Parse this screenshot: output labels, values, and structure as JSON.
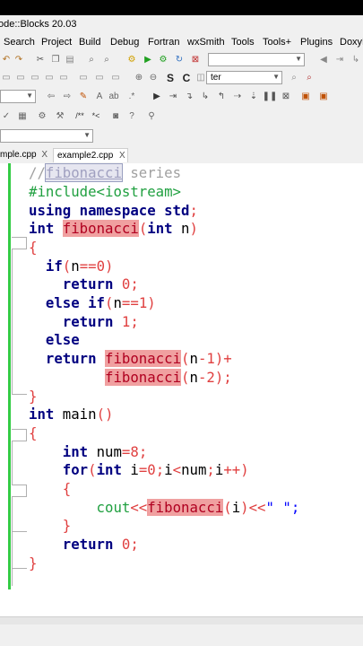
{
  "window": {
    "title": "ode::Blocks 20.03"
  },
  "menu": [
    "Search",
    "Project",
    "Build",
    "Debug",
    "Fortran",
    "wxSmith",
    "Tools",
    "Tools+",
    "Plugins",
    "DoxyB"
  ],
  "toolbar": {
    "search_combo": "ter"
  },
  "tabs": [
    {
      "label": "mple.cpp",
      "close": "X",
      "active": false
    },
    {
      "label": "example2.cpp",
      "close": "X",
      "active": true
    }
  ],
  "code_lines": [
    [
      {
        "t": "//",
        "c": "cm"
      },
      {
        "t": "fibonacci",
        "c": "hlc"
      },
      {
        "t": " series",
        "c": "cm"
      }
    ],
    [
      {
        "t": "#include<iostream>",
        "c": "pp"
      }
    ],
    [
      {
        "t": "using namespace std",
        "c": "kw"
      },
      {
        "t": ";",
        "c": "op"
      }
    ],
    [
      {
        "t": "int",
        "c": "kw"
      },
      {
        "t": " ",
        "c": "id"
      },
      {
        "t": "fibonacci",
        "c": "hl"
      },
      {
        "t": "(",
        "c": "op"
      },
      {
        "t": "int",
        "c": "kw"
      },
      {
        "t": " n",
        "c": "id"
      },
      {
        "t": ")",
        "c": "op"
      }
    ],
    [
      {
        "t": "{",
        "c": "brace"
      }
    ],
    [
      {
        "t": "  if",
        "c": "kw"
      },
      {
        "t": "(",
        "c": "op"
      },
      {
        "t": "n",
        "c": "id"
      },
      {
        "t": "==",
        "c": "op"
      },
      {
        "t": "0",
        "c": "num"
      },
      {
        "t": ")",
        "c": "op"
      }
    ],
    [
      {
        "t": "    return",
        "c": "kw"
      },
      {
        "t": " ",
        "c": "id"
      },
      {
        "t": "0",
        "c": "num"
      },
      {
        "t": ";",
        "c": "op"
      }
    ],
    [
      {
        "t": "  else if",
        "c": "kw"
      },
      {
        "t": "(",
        "c": "op"
      },
      {
        "t": "n",
        "c": "id"
      },
      {
        "t": "==",
        "c": "op"
      },
      {
        "t": "1",
        "c": "num"
      },
      {
        "t": ")",
        "c": "op"
      }
    ],
    [
      {
        "t": "    return",
        "c": "kw"
      },
      {
        "t": " ",
        "c": "id"
      },
      {
        "t": "1",
        "c": "num"
      },
      {
        "t": ";",
        "c": "op"
      }
    ],
    [
      {
        "t": "  else",
        "c": "kw"
      }
    ],
    [
      {
        "t": "  return",
        "c": "kw"
      },
      {
        "t": " ",
        "c": "id"
      },
      {
        "t": "fibonacci",
        "c": "hl"
      },
      {
        "t": "(",
        "c": "op"
      },
      {
        "t": "n",
        "c": "id"
      },
      {
        "t": "-",
        "c": "op"
      },
      {
        "t": "1",
        "c": "num"
      },
      {
        "t": ")+",
        "c": "op"
      }
    ],
    [
      {
        "t": "         ",
        "c": "id"
      },
      {
        "t": "fibonacci",
        "c": "hl"
      },
      {
        "t": "(",
        "c": "op"
      },
      {
        "t": "n",
        "c": "id"
      },
      {
        "t": "-",
        "c": "op"
      },
      {
        "t": "2",
        "c": "num"
      },
      {
        "t": ");",
        "c": "op"
      }
    ],
    [
      {
        "t": "}",
        "c": "brace"
      }
    ],
    [
      {
        "t": "int",
        "c": "kw"
      },
      {
        "t": " main",
        "c": "id"
      },
      {
        "t": "()",
        "c": "op"
      }
    ],
    [
      {
        "t": "{",
        "c": "brace"
      }
    ],
    [
      {
        "t": "    int",
        "c": "kw"
      },
      {
        "t": " num",
        "c": "id"
      },
      {
        "t": "=",
        "c": "op"
      },
      {
        "t": "8",
        "c": "num"
      },
      {
        "t": ";",
        "c": "op"
      }
    ],
    [
      {
        "t": "    for",
        "c": "kw"
      },
      {
        "t": "(",
        "c": "op"
      },
      {
        "t": "int",
        "c": "kw"
      },
      {
        "t": " i",
        "c": "id"
      },
      {
        "t": "=",
        "c": "op"
      },
      {
        "t": "0",
        "c": "num"
      },
      {
        "t": ";",
        "c": "op"
      },
      {
        "t": "i",
        "c": "id"
      },
      {
        "t": "<",
        "c": "op"
      },
      {
        "t": "num",
        "c": "id"
      },
      {
        "t": ";",
        "c": "op"
      },
      {
        "t": "i",
        "c": "id"
      },
      {
        "t": "++)",
        "c": "op"
      }
    ],
    [
      {
        "t": "    {",
        "c": "brace"
      }
    ],
    [
      {
        "t": "        cout",
        "c": "pp"
      },
      {
        "t": "<<",
        "c": "op"
      },
      {
        "t": "fibonacci",
        "c": "hl"
      },
      {
        "t": "(",
        "c": "op"
      },
      {
        "t": "i",
        "c": "id"
      },
      {
        "t": ")<<",
        "c": "op"
      },
      {
        "t": "\" \";",
        "c": "str"
      }
    ],
    [
      {
        "t": "    }",
        "c": "brace"
      }
    ],
    [
      {
        "t": "    return",
        "c": "kw"
      },
      {
        "t": " ",
        "c": "id"
      },
      {
        "t": "0",
        "c": "num"
      },
      {
        "t": ";",
        "c": "op"
      }
    ],
    [
      {
        "t": "}",
        "c": "brace"
      }
    ]
  ]
}
